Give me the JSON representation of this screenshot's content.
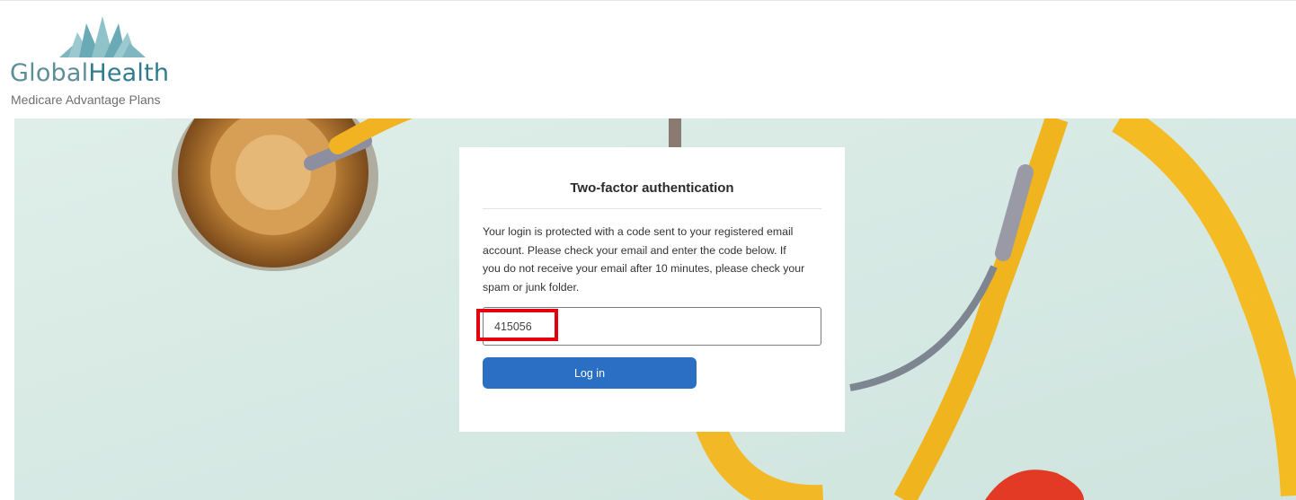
{
  "brand": {
    "name_part1": "Global",
    "name_part2": "Health",
    "tagline": "Medicare Advantage Plans",
    "colors": {
      "logo_teal_light": "#8fc3c9",
      "logo_teal_dark": "#2f7c8f",
      "wordmark_light": "#5e8e98"
    }
  },
  "hero": {
    "background_color": "#d9ebe5",
    "image_description_icon": "stethoscope-background-image"
  },
  "auth_card": {
    "title": "Two-factor authentication",
    "message": "Your login is protected with a code sent to your registered email account. Please check your email and enter the code below. If you do not receive your email after 10 minutes, please check your spam or junk folder.",
    "code_input": {
      "value": "415056",
      "placeholder": ""
    },
    "login_button_label": "Log in",
    "button_color": "#2a6fc4",
    "highlight_color": "#e3000f"
  }
}
